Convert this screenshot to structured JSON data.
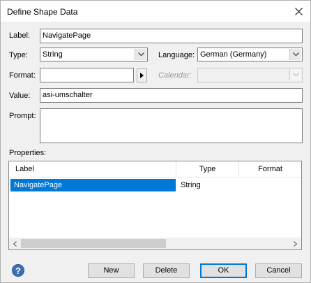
{
  "window": {
    "title": "Define Shape Data"
  },
  "labels": {
    "label": "Label:",
    "type": "Type:",
    "language": "Language:",
    "format": "Format:",
    "calendar": "Calendar:",
    "value": "Value:",
    "prompt": "Prompt:",
    "properties": "Properties:"
  },
  "fields": {
    "label_value": "NavigatePage",
    "type_value": "String",
    "language_value": "German (Germany)",
    "format_value": "",
    "calendar_value": "",
    "value_value": "asi-umschalter",
    "prompt_value": ""
  },
  "properties_table": {
    "columns": [
      "Label",
      "Type",
      "Format"
    ],
    "rows": [
      {
        "label": "NavigatePage",
        "type": "String",
        "format": ""
      }
    ]
  },
  "buttons": {
    "new": "New",
    "delete": "Delete",
    "ok": "OK",
    "cancel": "Cancel",
    "help": "?"
  },
  "icons": {
    "close": "close-icon",
    "dropdown": "chevron-down-icon",
    "format_picker": "triangle-right-icon",
    "help": "help-icon"
  },
  "colors": {
    "selection": "#0078d7",
    "help": "#3a6fb0"
  }
}
